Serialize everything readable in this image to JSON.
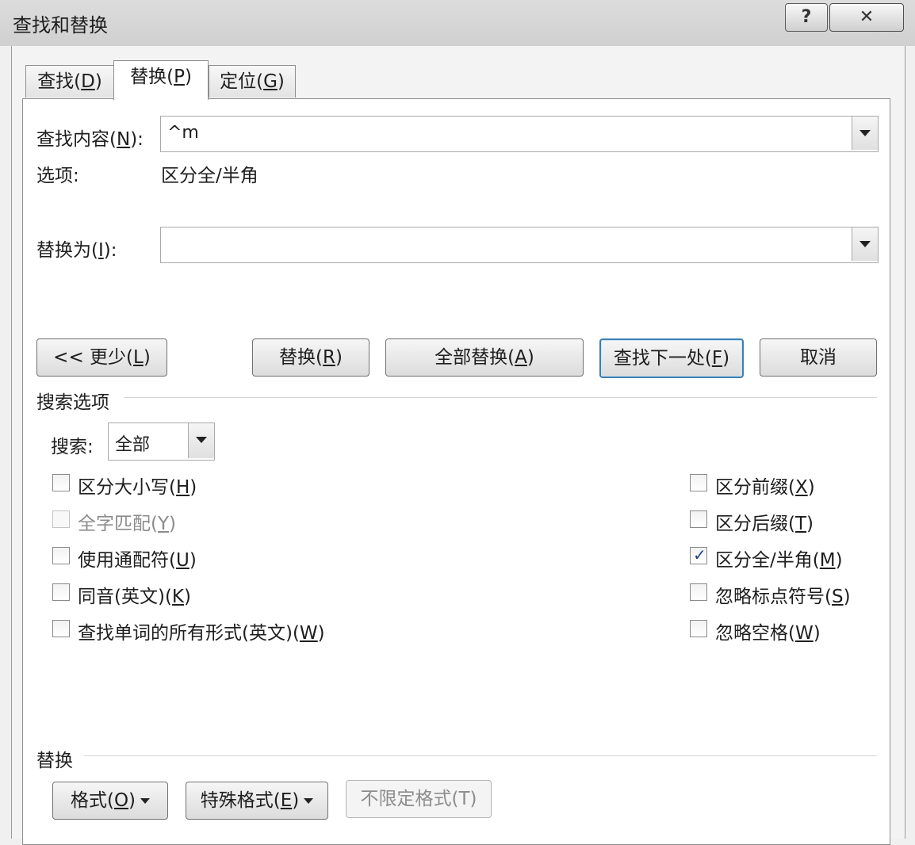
{
  "window": {
    "title": "查找和替换",
    "help": "?",
    "close": "✕"
  },
  "tabs": [
    {
      "text": "查找(",
      "key": "D",
      "end": ")"
    },
    {
      "text": "替换(",
      "key": "P",
      "end": ")"
    },
    {
      "text": "定位(",
      "key": "G",
      "end": ")"
    }
  ],
  "find": {
    "label_a": "查找内容(",
    "label_key": "N",
    "label_b": "):",
    "value": "^m"
  },
  "options": {
    "label": "选项:",
    "value": "区分全/半角"
  },
  "replace_with": {
    "label_a": "替换为(",
    "label_key": "I",
    "label_b": "):",
    "value": ""
  },
  "buttons": {
    "less": {
      "a": "<< 更少(",
      "key": "L",
      "b": ")"
    },
    "replace": {
      "a": "替换(",
      "key": "R",
      "b": ")"
    },
    "replace_all": {
      "a": "全部替换(",
      "key": "A",
      "b": ")"
    },
    "find_next": {
      "a": "查找下一处(",
      "key": "F",
      "b": ")"
    },
    "cancel": "取消"
  },
  "search_options": {
    "heading": "搜索选项",
    "search_label": "搜索:",
    "search_value": "全部",
    "left": [
      {
        "a": "区分大小写(",
        "key": "H",
        "b": ")",
        "checked": false,
        "disabled": false
      },
      {
        "a": "全字匹配(",
        "key": "Y",
        "b": ")",
        "checked": false,
        "disabled": true
      },
      {
        "a": "使用通配符(",
        "key": "U",
        "b": ")",
        "checked": false,
        "disabled": false
      },
      {
        "a": "同音(英文)(",
        "key": "K",
        "b": ")",
        "checked": false,
        "disabled": false
      },
      {
        "a": "查找单词的所有形式(英文)(",
        "key": "W",
        "b": ")",
        "checked": false,
        "disabled": false
      }
    ],
    "right": [
      {
        "a": "区分前缀(",
        "key": "X",
        "b": ")",
        "checked": false
      },
      {
        "a": "区分后缀(",
        "key": "T",
        "b": ")",
        "checked": false
      },
      {
        "a": "区分全/半角(",
        "key": "M",
        "b": ")",
        "checked": true
      },
      {
        "a": "忽略标点符号(",
        "key": "S",
        "b": ")",
        "checked": false
      },
      {
        "a": "忽略空格(",
        "key": "W",
        "b": ")",
        "checked": false
      }
    ]
  },
  "replace_section": {
    "heading": "替换",
    "format": {
      "a": "格式(",
      "key": "O",
      "b": ")"
    },
    "special": {
      "a": "特殊格式(",
      "key": "E",
      "b": ")"
    },
    "no_format": "不限定格式(T)"
  },
  "check_glyph": "✓"
}
